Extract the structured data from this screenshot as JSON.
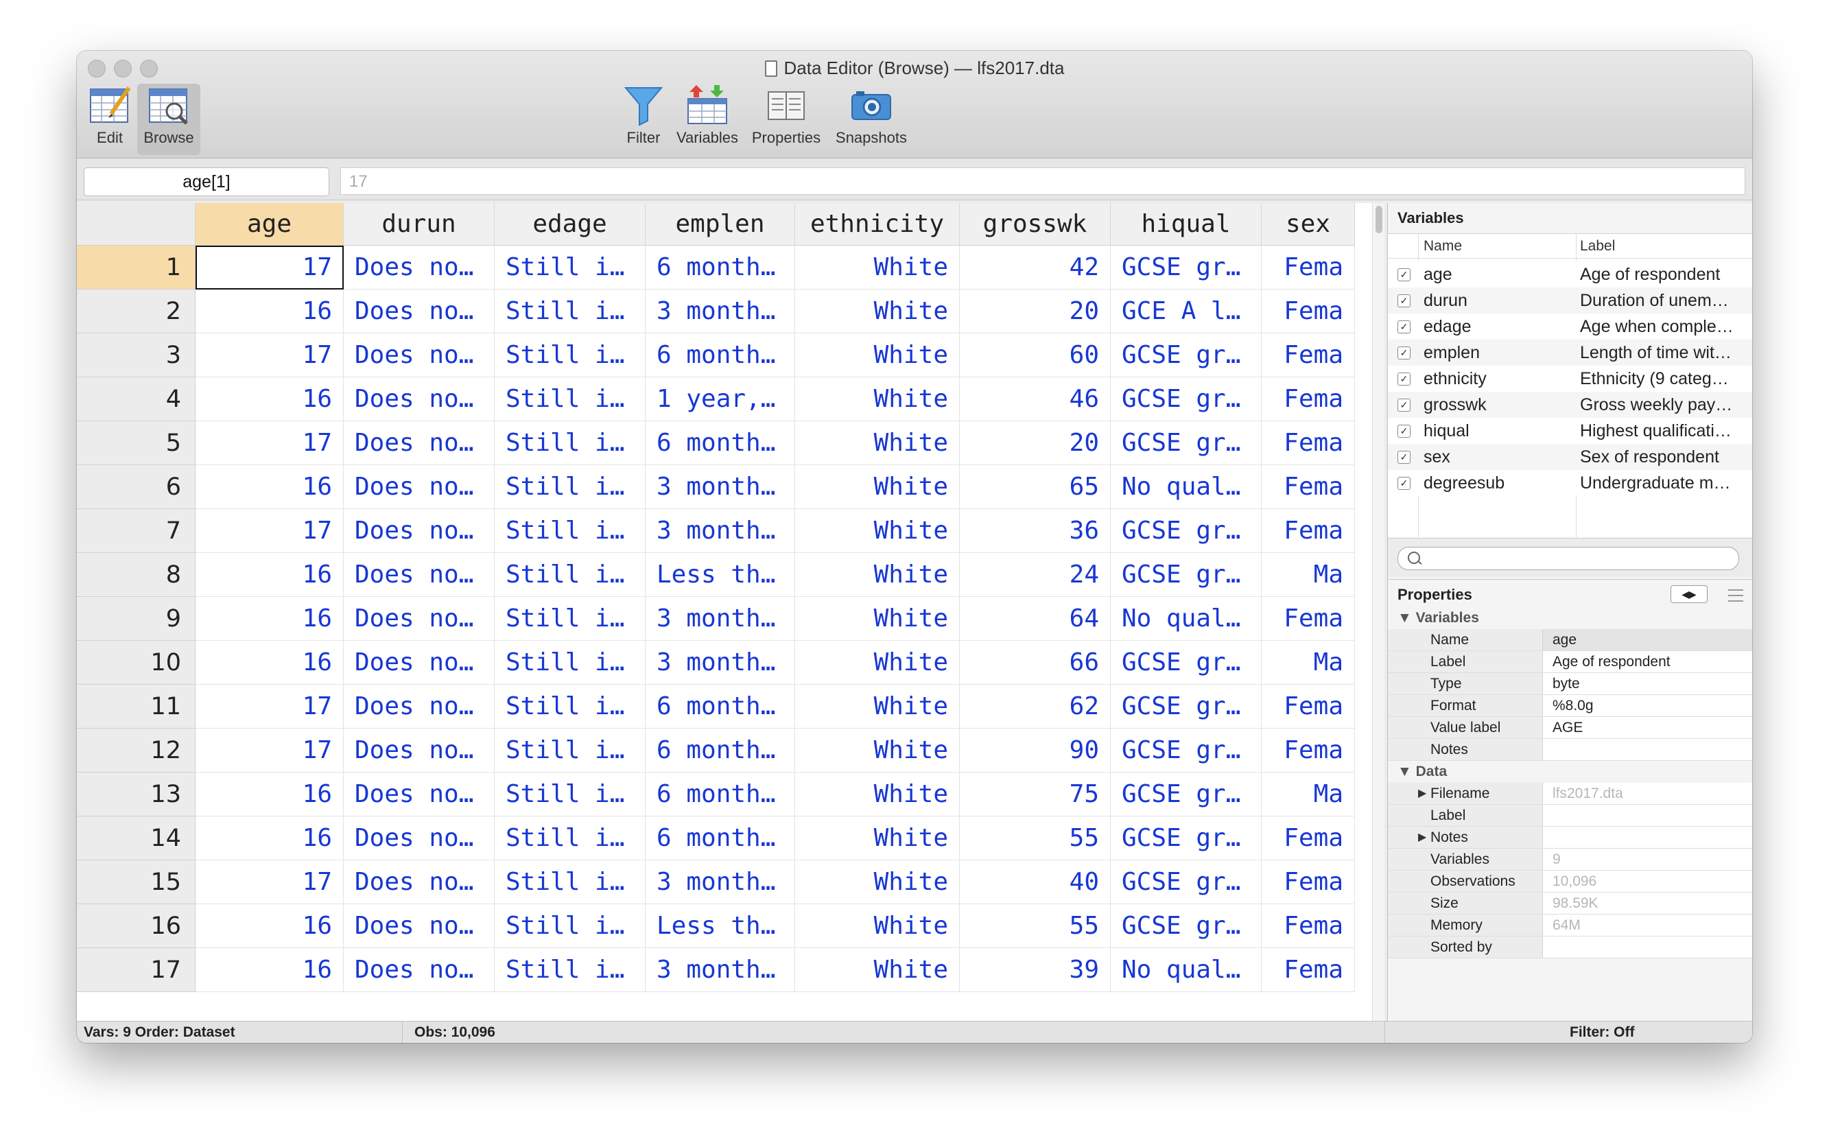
{
  "window": {
    "title": "Data Editor (Browse) — lfs2017.dta"
  },
  "toolbar": {
    "edit": "Edit",
    "browse": "Browse",
    "filter": "Filter",
    "variables": "Variables",
    "properties": "Properties",
    "snapshots": "Snapshots"
  },
  "cellbar": {
    "name": "age[1]",
    "value": "17"
  },
  "grid": {
    "columns": [
      "age",
      "durun",
      "edage",
      "emplen",
      "ethnicity",
      "grosswk",
      "hiqual",
      "sex"
    ],
    "rows": [
      [
        "17",
        "Does no…",
        "Still i…",
        "6 month…",
        "White",
        "42",
        "GCSE gr…",
        "Fema"
      ],
      [
        "16",
        "Does no…",
        "Still i…",
        "3 month…",
        "White",
        "20",
        "GCE A l…",
        "Fema"
      ],
      [
        "17",
        "Does no…",
        "Still i…",
        "6 month…",
        "White",
        "60",
        "GCSE gr…",
        "Fema"
      ],
      [
        "16",
        "Does no…",
        "Still i…",
        "1 year,…",
        "White",
        "46",
        "GCSE gr…",
        "Fema"
      ],
      [
        "17",
        "Does no…",
        "Still i…",
        "6 month…",
        "White",
        "20",
        "GCSE gr…",
        "Fema"
      ],
      [
        "16",
        "Does no…",
        "Still i…",
        "3 month…",
        "White",
        "65",
        "No qual…",
        "Fema"
      ],
      [
        "17",
        "Does no…",
        "Still i…",
        "3 month…",
        "White",
        "36",
        "GCSE gr…",
        "Fema"
      ],
      [
        "16",
        "Does no…",
        "Still i…",
        "Less th…",
        "White",
        "24",
        "GCSE gr…",
        "Ma"
      ],
      [
        "16",
        "Does no…",
        "Still i…",
        "3 month…",
        "White",
        "64",
        "No qual…",
        "Fema"
      ],
      [
        "16",
        "Does no…",
        "Still i…",
        "3 month…",
        "White",
        "66",
        "GCSE gr…",
        "Ma"
      ],
      [
        "17",
        "Does no…",
        "Still i…",
        "6 month…",
        "White",
        "62",
        "GCSE gr…",
        "Fema"
      ],
      [
        "17",
        "Does no…",
        "Still i…",
        "6 month…",
        "White",
        "90",
        "GCSE gr…",
        "Fema"
      ],
      [
        "16",
        "Does no…",
        "Still i…",
        "6 month…",
        "White",
        "75",
        "GCSE gr…",
        "Ma"
      ],
      [
        "16",
        "Does no…",
        "Still i…",
        "6 month…",
        "White",
        "55",
        "GCSE gr…",
        "Fema"
      ],
      [
        "17",
        "Does no…",
        "Still i…",
        "3 month…",
        "White",
        "40",
        "GCSE gr…",
        "Fema"
      ],
      [
        "16",
        "Does no…",
        "Still i…",
        "Less th…",
        "White",
        "55",
        "GCSE gr…",
        "Fema"
      ],
      [
        "16",
        "Does no…",
        "Still i…",
        "3 month…",
        "White",
        "39",
        "No qual…",
        "Fema"
      ]
    ]
  },
  "variables_panel": {
    "title": "Variables",
    "col_name": "Name",
    "col_label": "Label",
    "items": [
      {
        "name": "age",
        "label": "Age of respondent"
      },
      {
        "name": "durun",
        "label": "Duration of unem…"
      },
      {
        "name": "edage",
        "label": "Age when comple…"
      },
      {
        "name": "emplen",
        "label": "Length of time wit…"
      },
      {
        "name": "ethnicity",
        "label": "Ethnicity (9 categ…"
      },
      {
        "name": "grosswk",
        "label": "Gross weekly pay…"
      },
      {
        "name": "hiqual",
        "label": "Highest qualificati…"
      },
      {
        "name": "sex",
        "label": "Sex of respondent"
      },
      {
        "name": "degreesub",
        "label": "Undergraduate m…"
      }
    ]
  },
  "properties_panel": {
    "title": "Properties",
    "variables_section": "Variables",
    "variables": [
      {
        "key": "Name",
        "value": "age"
      },
      {
        "key": "Label",
        "value": "Age of respondent"
      },
      {
        "key": "Type",
        "value": "byte"
      },
      {
        "key": "Format",
        "value": "%8.0g"
      },
      {
        "key": "Value label",
        "value": "AGE"
      },
      {
        "key": "Notes",
        "value": ""
      }
    ],
    "data_section": "Data",
    "data": [
      {
        "key": "Filename",
        "value": "lfs2017.dta"
      },
      {
        "key": "Label",
        "value": ""
      },
      {
        "key": "Notes",
        "value": ""
      },
      {
        "key": "Variables",
        "value": "9"
      },
      {
        "key": "Observations",
        "value": "10,096"
      },
      {
        "key": "Size",
        "value": "98.59K"
      },
      {
        "key": "Memory",
        "value": "64M"
      },
      {
        "key": "Sorted by",
        "value": ""
      }
    ]
  },
  "statusbar": {
    "vars": "Vars: 9  Order: Dataset",
    "obs": "Obs: 10,096",
    "filter": "Filter: Off"
  },
  "colors": {
    "value_text": "#1737d4",
    "selected_header": "#f7dca9"
  }
}
